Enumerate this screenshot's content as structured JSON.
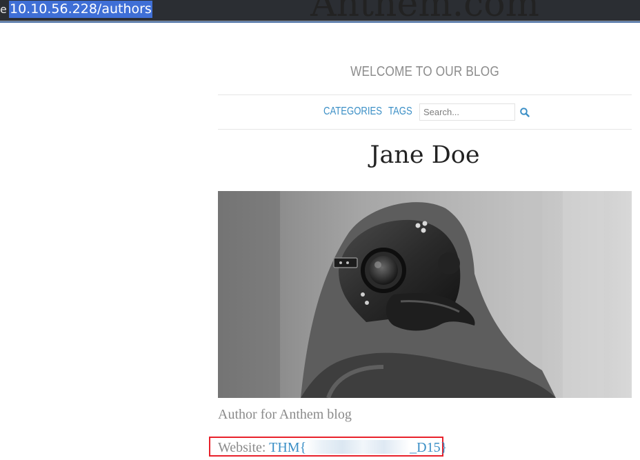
{
  "browser": {
    "url": "10.10.56.228/authors",
    "edge_glyph": "e"
  },
  "site": {
    "title": "Anthem.com",
    "tagline": "WELCOME TO OUR BLOG"
  },
  "nav": {
    "categories_label": "CATEGORIES",
    "tags_label": "TAGS",
    "search_placeholder": "Search...",
    "search_icon": "search-icon"
  },
  "author": {
    "name": "Jane Doe",
    "photo_desc": "plague-doctor-mask-photo",
    "bio": "Author for Anthem blog",
    "website_label": "Website:",
    "website_prefix": "THM{",
    "website_suffix": "_D15}"
  },
  "colors": {
    "link": "#3b8fc6",
    "highlight_box": "#e8202a",
    "url_selection": "#3f6fd6"
  }
}
